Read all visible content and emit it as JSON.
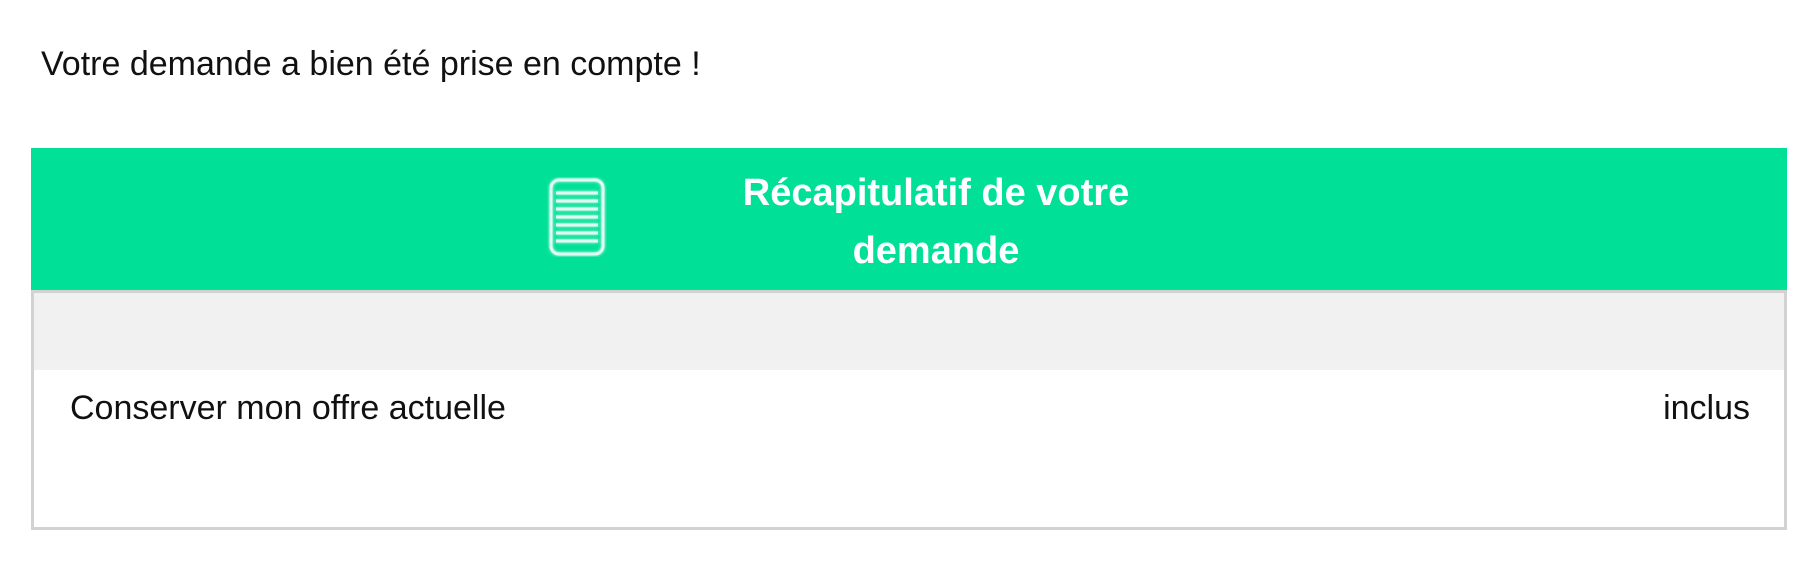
{
  "page": {
    "confirmation_message": "Votre demande a bien été prise en compte !"
  },
  "summary": {
    "title": "Récapitulatif de votre demande",
    "header_color": "#00e096",
    "icon": "document-lines-icon",
    "items": [
      {
        "label": "Conserver mon offre actuelle",
        "price": "inclus"
      }
    ]
  }
}
